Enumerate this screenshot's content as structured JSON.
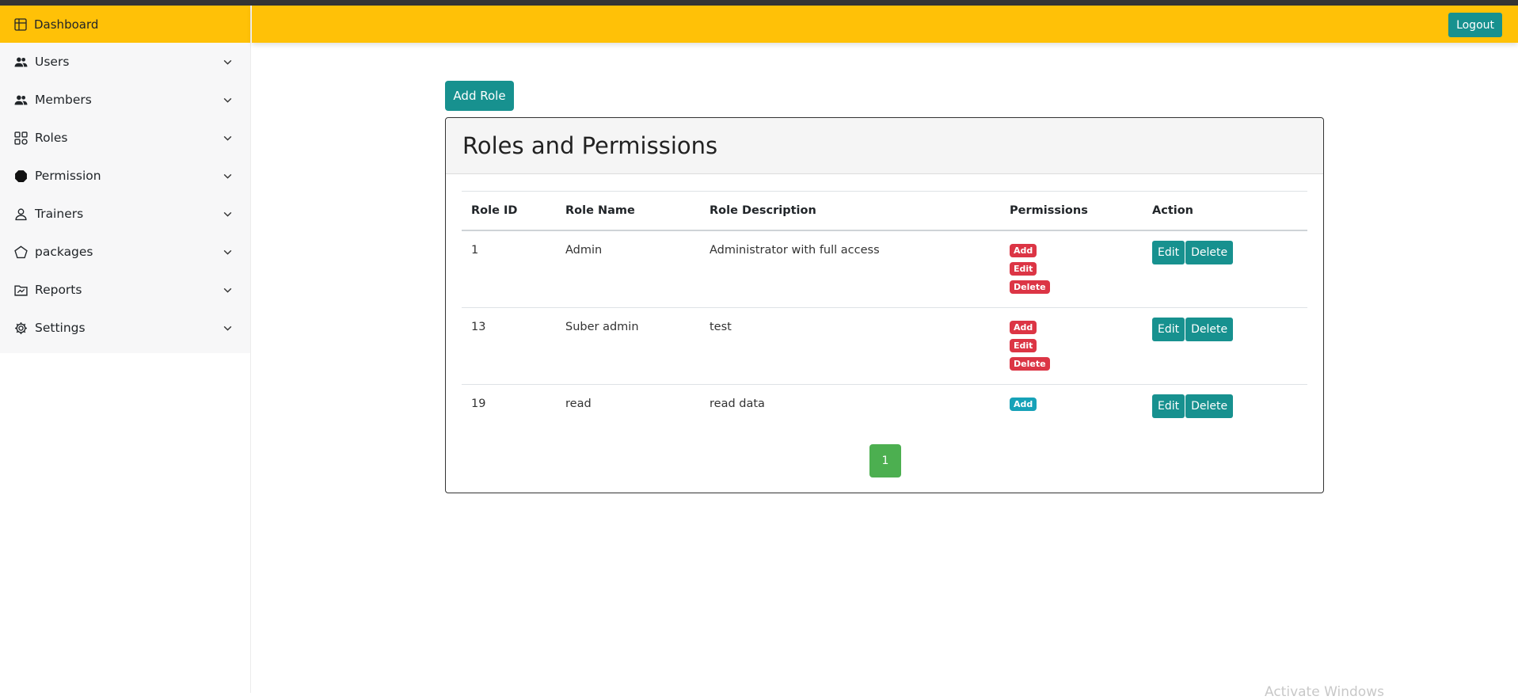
{
  "sidebar": {
    "dashboard_label": "Dashboard",
    "items": [
      {
        "label": "Users",
        "icon": "users-icon"
      },
      {
        "label": "Members",
        "icon": "users-icon"
      },
      {
        "label": "Roles",
        "icon": "roles-grid-icon"
      },
      {
        "label": "Permission",
        "icon": "octagon-icon"
      },
      {
        "label": "Trainers",
        "icon": "person-icon"
      },
      {
        "label": "packages",
        "icon": "pentagon-icon"
      },
      {
        "label": "Reports",
        "icon": "folder-icon"
      },
      {
        "label": "Settings",
        "icon": "gear-icon"
      }
    ]
  },
  "navbar": {
    "logout_label": "Logout",
    "color": "#ffc107"
  },
  "main": {
    "add_role_label": "Add Role",
    "card_title": "Roles and Permissions",
    "table": {
      "headers": [
        "Role ID",
        "Role Name",
        "Role Description",
        "Permissions",
        "Action"
      ],
      "rows": [
        {
          "id": "1",
          "name": "Admin",
          "description": "Administrator with full access",
          "permissions": [
            "Add",
            "Edit",
            "Delete"
          ],
          "edit_label": "Edit",
          "delete_label": "Delete"
        },
        {
          "id": "13",
          "name": "Suber admin",
          "description": "test",
          "permissions": [
            "Add",
            "Edit",
            "Delete"
          ],
          "edit_label": "Edit",
          "delete_label": "Delete"
        },
        {
          "id": "19",
          "name": "read",
          "description": "read data",
          "permissions": [
            "Add"
          ],
          "edit_label": "Edit",
          "delete_label": "Delete"
        }
      ]
    },
    "pagination": {
      "current_page": "1"
    }
  },
  "watermark": "Activate Windows",
  "colors": {
    "accent": "#17918f",
    "badge_danger": "#dc3545",
    "badge_info": "#17a2b8",
    "pager": "#4caf50"
  }
}
